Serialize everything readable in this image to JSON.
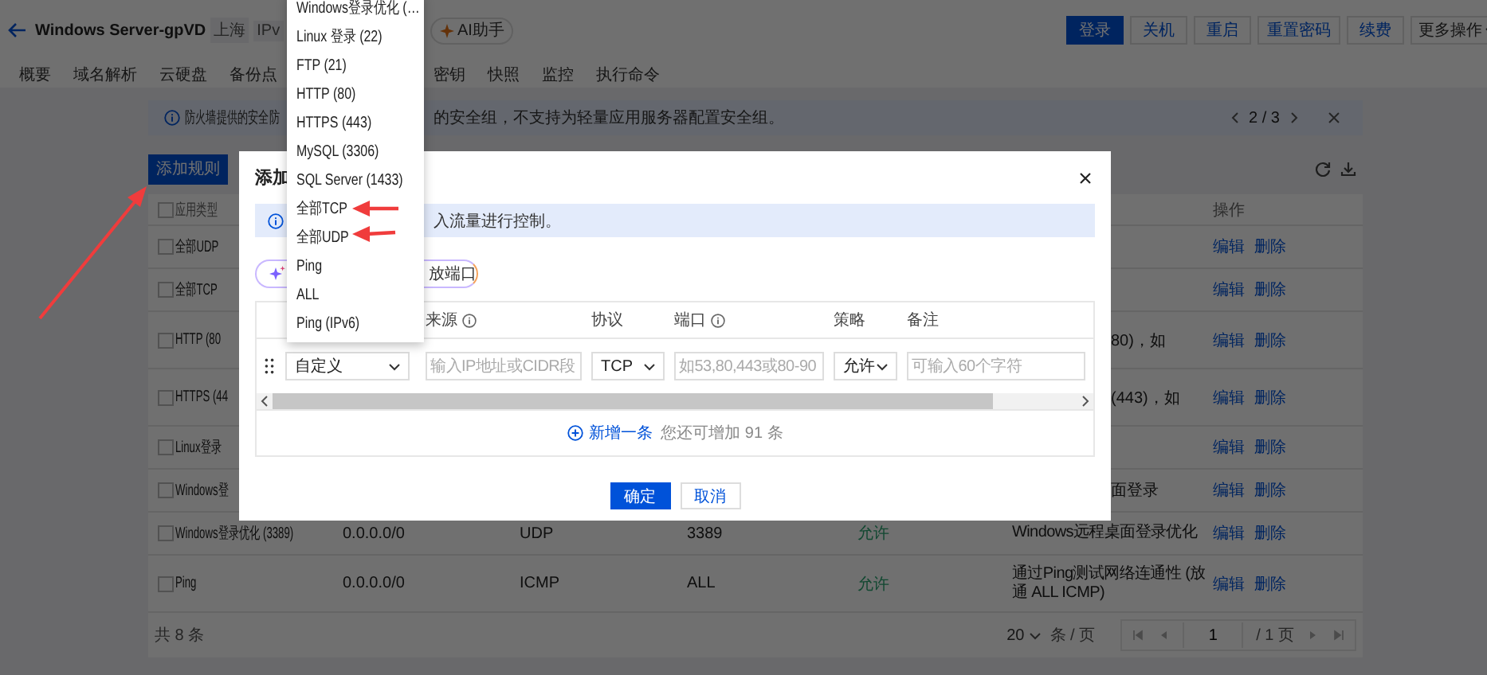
{
  "header": {
    "title": "Windows Server-gpVD",
    "tags": [
      "上海",
      "IPv"
    ],
    "assistant": "AI助手",
    "actions": [
      {
        "label": "登录",
        "primary": true
      },
      {
        "label": "关机",
        "primary": false
      },
      {
        "label": "重启",
        "primary": false
      },
      {
        "label": "重置密码",
        "primary": false
      },
      {
        "label": "续费",
        "primary": false
      }
    ],
    "more": "更多操作"
  },
  "tabs": [
    "概要",
    "域名解析",
    "云硬盘",
    "备份点",
    "密钥",
    "快照",
    "监控",
    "执行命令"
  ],
  "notice": {
    "text_start": "防火墙提供的安全防",
    "text_end": "的安全组，不支持为轻量应用服务器配置安全组。",
    "pager": "2 / 3"
  },
  "add_button": "添加规则",
  "table": {
    "columns": {
      "app": "应用类型",
      "actions": "操作"
    },
    "all_checked": false,
    "rows": [
      {
        "checked": false,
        "app": "全部UDP",
        "actions": [
          "编辑",
          "删除"
        ]
      },
      {
        "checked": false,
        "app": "全部TCP",
        "actions": [
          "编辑",
          "删除"
        ]
      },
      {
        "checked": false,
        "app": "HTTP (80",
        "note_fragment": "80)，如",
        "actions": [
          "编辑",
          "删除"
        ]
      },
      {
        "checked": false,
        "app": "HTTPS (44",
        "note_fragment": "(443)，如",
        "actions": [
          "编辑",
          "删除"
        ]
      },
      {
        "checked": false,
        "app": "Linux登录",
        "actions": [
          "编辑",
          "删除"
        ]
      },
      {
        "checked": false,
        "app": "Windows登",
        "note_fragment": "面登录",
        "actions": [
          "编辑",
          "删除"
        ]
      },
      {
        "checked": false,
        "app": "Windows登录优化 (3389)",
        "source": "0.0.0.0/0",
        "protocol": "UDP",
        "port": "3389",
        "policy": "允许",
        "note": "Windows远程桌面登录优化",
        "actions": [
          "编辑",
          "删除"
        ]
      },
      {
        "checked": false,
        "app": "Ping",
        "source": "0.0.0.0/0",
        "protocol": "ICMP",
        "port": "ALL",
        "policy": "允许",
        "note": "通过Ping测试网络连通性 (放通 ALL ICMP)",
        "actions": [
          "编辑",
          "删除"
        ]
      }
    ],
    "footer": {
      "total": "共 8 条",
      "page_size": "20",
      "per_page": "条 / 页",
      "page": "1",
      "pages": "/ 1 页"
    }
  },
  "modal": {
    "title": "添加",
    "info": "入流量进行控制。",
    "pill": "放端口",
    "columns": [
      {
        "label": "来源",
        "help": true
      },
      {
        "label": "协议",
        "help": false
      },
      {
        "label": "端口",
        "help": true
      },
      {
        "label": "策略",
        "help": false
      },
      {
        "label": "备注",
        "help": false
      }
    ],
    "row": {
      "type": "自定义",
      "source_placeholder": "输入IP地址或CIDR段",
      "protocol": "TCP",
      "port_placeholder": "如53,80,443或80-90",
      "policy": "允许",
      "note_placeholder": "可输入60个字符"
    },
    "add_link": "新增一条",
    "remaining": "您还可增加 91 条",
    "ok": "确定",
    "cancel": "取消"
  },
  "dropdown": [
    "Windows登录优化 (…",
    "Linux 登录 (22)",
    "FTP (21)",
    "HTTP (80)",
    "HTTPS (443)",
    "MySQL (3306)",
    "SQL Server (1433)",
    "全部TCP",
    "全部UDP",
    "Ping",
    "ALL",
    "Ping (IPv6)"
  ]
}
